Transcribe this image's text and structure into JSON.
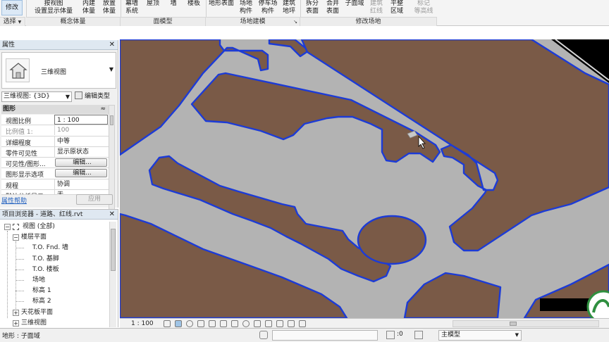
{
  "ribbon": {
    "modify": "修改",
    "select": "选择",
    "select_arrow": "▼",
    "buttons": {
      "show_mass": [
        "按视图",
        "设置显示体量"
      ],
      "in_place_mass": [
        "内建",
        "体量"
      ],
      "place_mass": [
        "放置",
        "体量"
      ],
      "curtain_system": [
        "幕墙",
        "系统"
      ],
      "roof": "屋顶",
      "wall": "墙",
      "floor": "楼板",
      "toposurface": "地形表面",
      "site_component": [
        "场地",
        "构件"
      ],
      "parking_component": [
        "停车场",
        "构件"
      ],
      "building_pad": [
        "建筑",
        "地坪"
      ],
      "split_surface": [
        "拆分",
        "表面"
      ],
      "merge_surfaces": [
        "合并",
        "表面"
      ],
      "subregion": "子面域",
      "property_line": [
        "建筑",
        "红线"
      ],
      "graded_region": [
        "平整",
        "区域"
      ],
      "label_contours": [
        "标记",
        "等高线"
      ]
    },
    "panels": {
      "conceptual_mass": "概念体量",
      "model_by_face": "面模型",
      "site_modeling": "场地建模",
      "modify_site": "修改场地"
    }
  },
  "properties": {
    "title": "属性",
    "close": "✕",
    "type_name": "三维视图",
    "type_arrow": "▼",
    "view_selector": "三维视图: {3D}",
    "view_selector_arrow": "▼",
    "edit_type": "编辑类型",
    "category": "图形",
    "category_toggle": "≈",
    "rows": [
      {
        "key": "视图比例",
        "value": "1 : 100"
      },
      {
        "key": "比例值 1:",
        "value": "100"
      },
      {
        "key": "详细程度",
        "value": "中等"
      },
      {
        "key": "零件可见性",
        "value": "显示原状态"
      },
      {
        "key": "可见性/图形...",
        "value": "编辑..."
      },
      {
        "key": "图形显示选项",
        "value": "编辑..."
      },
      {
        "key": "规程",
        "value": "协调"
      },
      {
        "key": "默认分析显示...",
        "value": "无"
      }
    ],
    "help": "属性帮助",
    "apply": "应用"
  },
  "browser": {
    "title": "项目浏览器 - 道路、红线.rvt",
    "close": "✕",
    "items": [
      {
        "label": "视图 (全部)",
        "level": 0,
        "toggle": "−"
      },
      {
        "label": "楼层平面",
        "level": 1,
        "toggle": "−"
      },
      {
        "label": "T.O. Fnd. 墙",
        "level": 2
      },
      {
        "label": "T.O. 基脚",
        "level": 2
      },
      {
        "label": "T.O. 楼板",
        "level": 2
      },
      {
        "label": "场地",
        "level": 2
      },
      {
        "label": "标高 1",
        "level": 2
      },
      {
        "label": "标高 2",
        "level": 2
      },
      {
        "label": "天花板平面",
        "level": 1,
        "toggle": "+"
      },
      {
        "label": "三维视图",
        "level": 1,
        "toggle": "+"
      }
    ]
  },
  "viewbar": {
    "scale": "1 : 100"
  },
  "statusbar": {
    "message": "地形 : 子面域",
    "count": ":0",
    "workset": "主模型",
    "workset_arrow": "▼"
  },
  "colors": {
    "terrain": "#7a5a47",
    "road": "#b3b3b3",
    "boundary": "#1c3bd6",
    "canvas_bg": "#b3b3b3",
    "accent": "#1f5fbf"
  }
}
